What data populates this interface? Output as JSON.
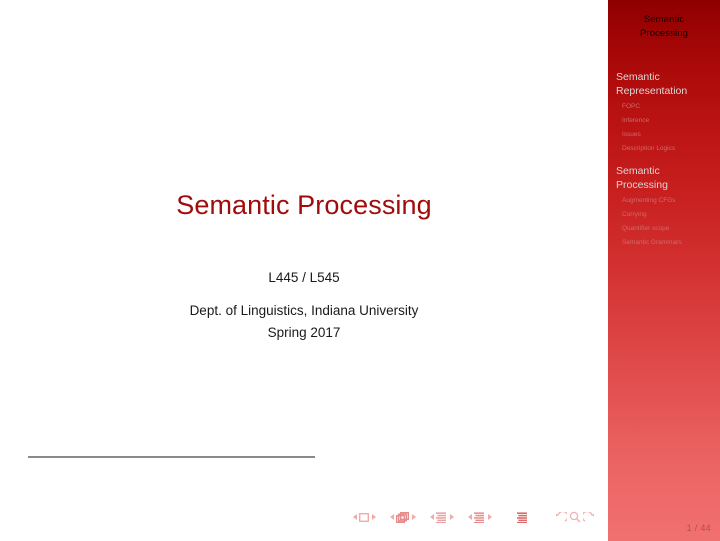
{
  "slide": {
    "title": "Semantic Processing",
    "course_code": "L445 / L545",
    "institute_line1": "Dept. of Linguistics, Indiana University",
    "institute_line2": "Spring 2017",
    "page_indicator": "1 / 44",
    "accent_color": "#a00c0c",
    "sidebar_top_color": "#8f0000",
    "sidebar_bottom_color": "#f07070",
    "rule_color": "#8a8a8a"
  },
  "sidebar": {
    "header_line1": "Semantic",
    "header_line2": "Processing",
    "sections": [
      {
        "title_line1": "Semantic",
        "title_line2": "Representation",
        "items": [
          {
            "label": "FOPC"
          },
          {
            "label": "Inference"
          },
          {
            "label": "Issues"
          },
          {
            "label": "Description Logics"
          }
        ]
      },
      {
        "title_line1": "Semantic",
        "title_line2": "Processing",
        "items": [
          {
            "label": "Augmenting CFGs"
          },
          {
            "label": "Currying"
          },
          {
            "label": "Quantifier scope"
          },
          {
            "label": "Semantic Grammars"
          }
        ]
      }
    ]
  },
  "navbar": {
    "icons": [
      "prev-slide-arrow-icon",
      "slide-icon",
      "next-slide-arrow-icon",
      "prev-frame-arrow-icon",
      "frames-icon",
      "next-frame-arrow-icon",
      "prev-subsection-arrow-icon",
      "subsection-icon",
      "next-subsection-arrow-icon",
      "prev-section-arrow-icon",
      "section-icon",
      "next-section-arrow-icon",
      "document-icon",
      "back-icon",
      "find-icon",
      "forward-icon"
    ]
  }
}
